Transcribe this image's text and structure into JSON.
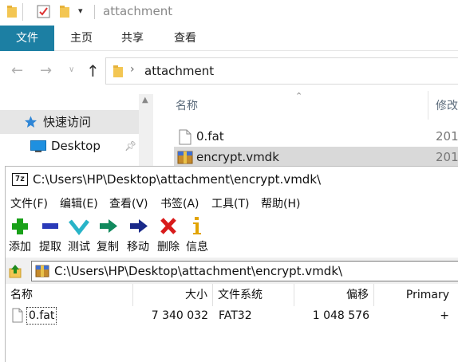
{
  "explorer": {
    "title": "attachment",
    "ribbon_tabs": [
      {
        "label": "文件",
        "active": true
      },
      {
        "label": "主页",
        "active": false
      },
      {
        "label": "共享",
        "active": false
      },
      {
        "label": "查看",
        "active": false
      }
    ],
    "address": {
      "path": "attachment"
    },
    "nav_items": [
      {
        "label": "快速访问",
        "icon": "star-icon",
        "selected": true
      },
      {
        "label": "Desktop",
        "icon": "desktop-icon",
        "pinned": true
      }
    ],
    "columns": {
      "name": "名称",
      "modified": "修改"
    },
    "files": [
      {
        "name": "0.fat",
        "date": "201",
        "icon": "file-icon",
        "selected": false
      },
      {
        "name": "encrypt.vmdk",
        "date": "201",
        "icon": "archive-icon",
        "selected": true
      }
    ]
  },
  "zip": {
    "title": "C:\\Users\\HP\\Desktop\\attachment\\encrypt.vmdk\\",
    "app_icon_text": "7z",
    "menu": [
      "文件(F)",
      "编辑(E)",
      "查看(V)",
      "书签(A)",
      "工具(T)",
      "帮助(H)"
    ],
    "toolbar": [
      {
        "label": "添加",
        "icon": "add-icon",
        "color": "#19a119"
      },
      {
        "label": "提取",
        "icon": "extract-icon",
        "color": "#2a3ab8"
      },
      {
        "label": "测试",
        "icon": "test-icon",
        "color": "#28b4c8"
      },
      {
        "label": "复制",
        "icon": "copy-icon",
        "color": "#128a5e"
      },
      {
        "label": "移动",
        "icon": "move-icon",
        "color": "#1a2a8a"
      },
      {
        "label": "删除",
        "icon": "delete-icon",
        "color": "#d81b1b"
      },
      {
        "label": "信息",
        "icon": "info-icon",
        "color": "#e2a400"
      }
    ],
    "path": "C:\\Users\\HP\\Desktop\\attachment\\encrypt.vmdk\\",
    "list": {
      "headers": {
        "name": "名称",
        "size": "大小",
        "fs": "文件系统",
        "offset": "偏移",
        "primary": "Primary"
      },
      "rows": [
        {
          "name": "0.fat",
          "size": "7 340 032",
          "fs": "FAT32",
          "offset": "1 048 576",
          "primary": "+"
        }
      ]
    }
  }
}
